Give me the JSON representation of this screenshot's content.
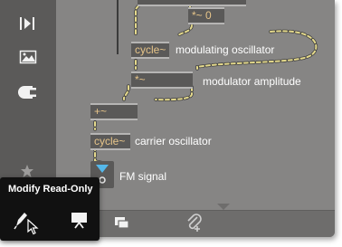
{
  "objects": {
    "mult_zero": "*~ 0",
    "mod_cycle": "cycle~",
    "mod_mult": "*~",
    "add": "+~",
    "carrier_cycle": "cycle~"
  },
  "comments": {
    "modulating_oscillator": "modulating oscillator",
    "modulator_amplitude": "modulator amplitude",
    "carrier_oscillator": "carrier oscillator",
    "fm_signal": "FM signal"
  },
  "tooltip": {
    "title": "Modify Read-Only"
  },
  "icons": {
    "sidebar": [
      "step-through-icon",
      "image-icon",
      "plug-icon",
      "star-icon"
    ],
    "tooltip": [
      "pencil-icon",
      "presentation-icon"
    ],
    "bottombar": [
      "windows-icon",
      "paperclip-icon"
    ]
  },
  "colors": {
    "canvas": "#868584",
    "sidebar": "#5b5a59",
    "object_box": "#5a5958",
    "object_text": "#e6c489",
    "patch_cord": "#e4d98c",
    "audio_cord": "#d8cf86",
    "tooltip_bg": "#111111",
    "cyan_accent": "#55b8ea"
  }
}
